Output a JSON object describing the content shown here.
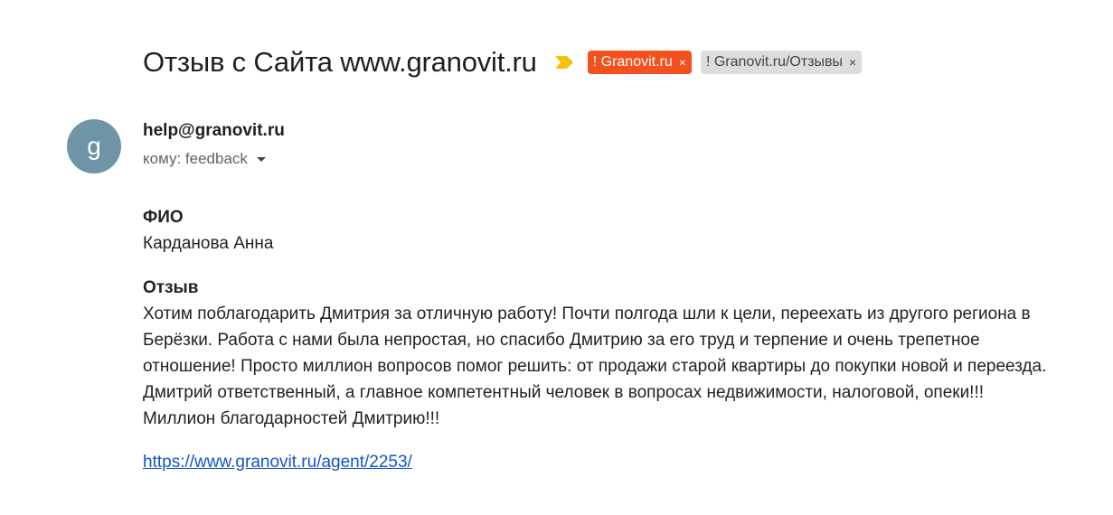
{
  "email": {
    "subject": "Отзыв с Сайта www.granovit.ru",
    "labels": [
      {
        "text": "! Granovit.ru",
        "remove": "×",
        "color": "#f4511e"
      },
      {
        "text": "! Granovit.ru/Отзывы",
        "remove": "×",
        "color": "#dddddd"
      }
    ],
    "importance_color": "#f4c20d",
    "avatar_letter": "g",
    "avatar_color": "#6f93a7",
    "sender": "help@granovit.ru",
    "recipient": "кому: feedback",
    "fields": {
      "name_title": "ФИО",
      "name_value": "Карданова Анна",
      "review_title": "Отзыв",
      "review_text": "Хотим поблагодарить Дмитрия за отличную работу! Почти полгода шли к цели, переехать из другого региона в Берёзки. Работа с нами была непростая, но спасибо Дмитрию за его труд и терпение и очень трепетное отношение! Просто миллион вопросов помог решить: от продажи старой квартиры до покупки новой и переезда. Дмитрий ответственный, а главное компетентный человек в вопросах недвижимости, налоговой, опеки!!! Миллион благодарностей Дмитрию!!!"
    },
    "link": "https://www.granovit.ru/agent/2253/"
  }
}
